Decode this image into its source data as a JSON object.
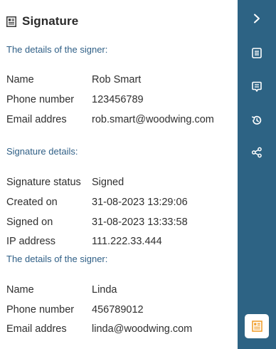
{
  "panel": {
    "title": "Signature",
    "sections": [
      {
        "heading": "The details of the signer:",
        "rows": [
          {
            "label": "Name",
            "value": "Rob Smart"
          },
          {
            "label": "Phone number",
            "value": "123456789"
          },
          {
            "label": "Email addres",
            "value": "rob.smart@woodwing.com"
          }
        ]
      },
      {
        "heading": "Signature details:",
        "rows": [
          {
            "label": "Signature status",
            "value": "Signed"
          },
          {
            "label": "Created on",
            "value": "31-08-2023 13:29:06"
          },
          {
            "label": "Signed on",
            "value": "31-08-2023 13:33:58"
          },
          {
            "label": "IP address",
            "value": "111.222.33.444"
          }
        ]
      },
      {
        "heading": "The details of the signer:",
        "rows": [
          {
            "label": "Name",
            "value": "Linda"
          },
          {
            "label": "Phone number",
            "value": "456789012"
          },
          {
            "label": "Email addres",
            "value": "linda@woodwing.com"
          }
        ]
      }
    ]
  },
  "rail": {
    "background": "#2d6384",
    "buttons": [
      "chevron-right-icon",
      "document-icon",
      "comment-icon",
      "history-icon",
      "share-icon"
    ],
    "bottom_button": "signature-icon",
    "bottom_accent": "#f0a030"
  },
  "colors": {
    "section_heading": "#2f5f86",
    "text": "#2f2f2f"
  }
}
